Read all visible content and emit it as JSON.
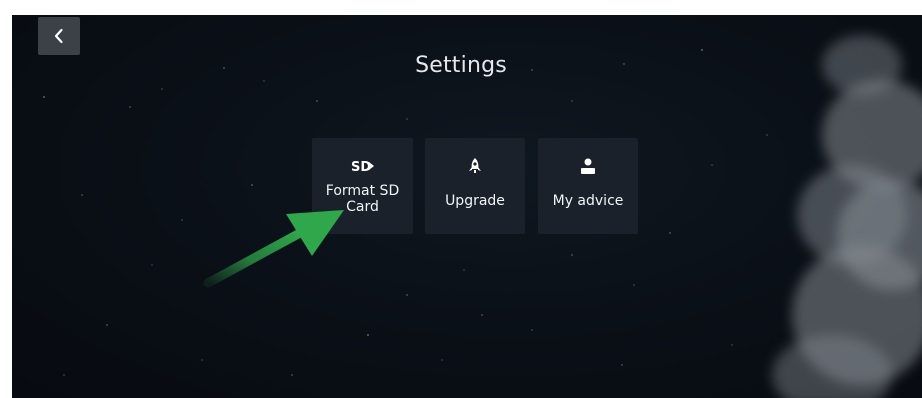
{
  "header": {
    "title": "Settings",
    "back_icon": "chevron-left-icon"
  },
  "tiles": [
    {
      "label": "Format SD\nCard",
      "icon": "sd-card-icon"
    },
    {
      "label": "Upgrade",
      "icon": "rocket-icon"
    },
    {
      "label": "My advice",
      "icon": "person-icon"
    }
  ],
  "annotation": {
    "arrow_color": "#2ea84a"
  },
  "colors": {
    "background": "#0a0f16",
    "tile": "#1c232c",
    "back_button": "#3b4147",
    "text": "#e6e8eb"
  }
}
